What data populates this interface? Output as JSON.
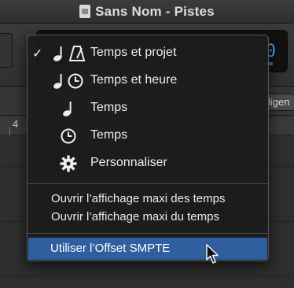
{
  "window": {
    "title": "Sans Nom - Pistes"
  },
  "toolbar": {
    "lcd_digit": "0",
    "align_label": "ligen"
  },
  "ruler": {
    "bar_number": "4"
  },
  "menu": {
    "items": [
      {
        "label": "Temps et projet",
        "checked": true,
        "icons": [
          "note-icon",
          "metronome-icon"
        ]
      },
      {
        "label": "Temps et heure",
        "checked": false,
        "icons": [
          "note-icon",
          "clock-icon"
        ]
      },
      {
        "label": "Temps",
        "checked": false,
        "icons": [
          "note-icon"
        ]
      },
      {
        "label": "Temps",
        "checked": false,
        "icons": [
          "clock-icon"
        ]
      },
      {
        "label": "Personnaliser",
        "checked": false,
        "icons": [
          "gear-icon"
        ]
      }
    ],
    "check_glyph": "✓",
    "open_items": [
      "Ouvrir l’affichage maxi des temps",
      "Ouvrir l’affichage maxi du temps"
    ],
    "highlighted_item": "Utiliser l’Offset SMPTE"
  },
  "colors": {
    "highlight": "#2f5f9e",
    "lcd_accent": "#4fa6ff"
  }
}
